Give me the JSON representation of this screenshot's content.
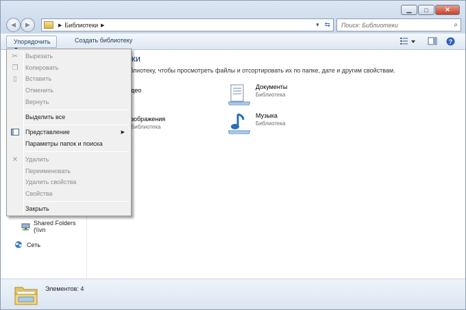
{
  "address": {
    "segments": [
      "Библиотеки"
    ]
  },
  "search": {
    "placeholder": "Поиск: Библиотеки"
  },
  "toolbar": {
    "organize_label": "Упорядочить",
    "create_label": "Создать библиотеку"
  },
  "content": {
    "title": "теки",
    "subtitle": "библиотеку, чтобы просмотреть файлы и отсортировать их по папке, дате и другим свойствам.",
    "libraries": [
      {
        "name": "део",
        "kind": ""
      },
      {
        "name": "Документы",
        "kind": "Библиотека"
      },
      {
        "name": "зображения",
        "kind": "Библиотека"
      },
      {
        "name": "Музыка",
        "kind": "Библиотека"
      }
    ]
  },
  "nav_pane": {
    "items": [
      {
        "label": "Shared Folders (\\\\vn"
      },
      {
        "label": "Сеть"
      }
    ]
  },
  "status": {
    "text": "Элементов: 4"
  },
  "menu": {
    "items": [
      {
        "label": "Вырезать",
        "enabled": false,
        "icon": "scissors-icon"
      },
      {
        "label": "Копировать",
        "enabled": false,
        "icon": "copy-icon"
      },
      {
        "label": "Вставить",
        "enabled": false,
        "icon": "paste-icon"
      },
      {
        "label": "Отменить",
        "enabled": false
      },
      {
        "label": "Вернуть",
        "enabled": false
      },
      {
        "label": "Выделить все",
        "enabled": true
      },
      {
        "label": "Представление",
        "enabled": true,
        "icon": "layout-icon",
        "submenu": true
      },
      {
        "label": "Параметры папок и поиска",
        "enabled": true
      },
      {
        "label": "Удалить",
        "enabled": false,
        "icon": "delete-icon"
      },
      {
        "label": "Переименовать",
        "enabled": false
      },
      {
        "label": "Удалить свойства",
        "enabled": false
      },
      {
        "label": "Свойства",
        "enabled": false
      },
      {
        "label": "Закрыть",
        "enabled": true
      }
    ]
  },
  "colors": {
    "title_blue": "#1e3287",
    "frame": "#dbe6f3",
    "close_red": "#c5402b"
  }
}
